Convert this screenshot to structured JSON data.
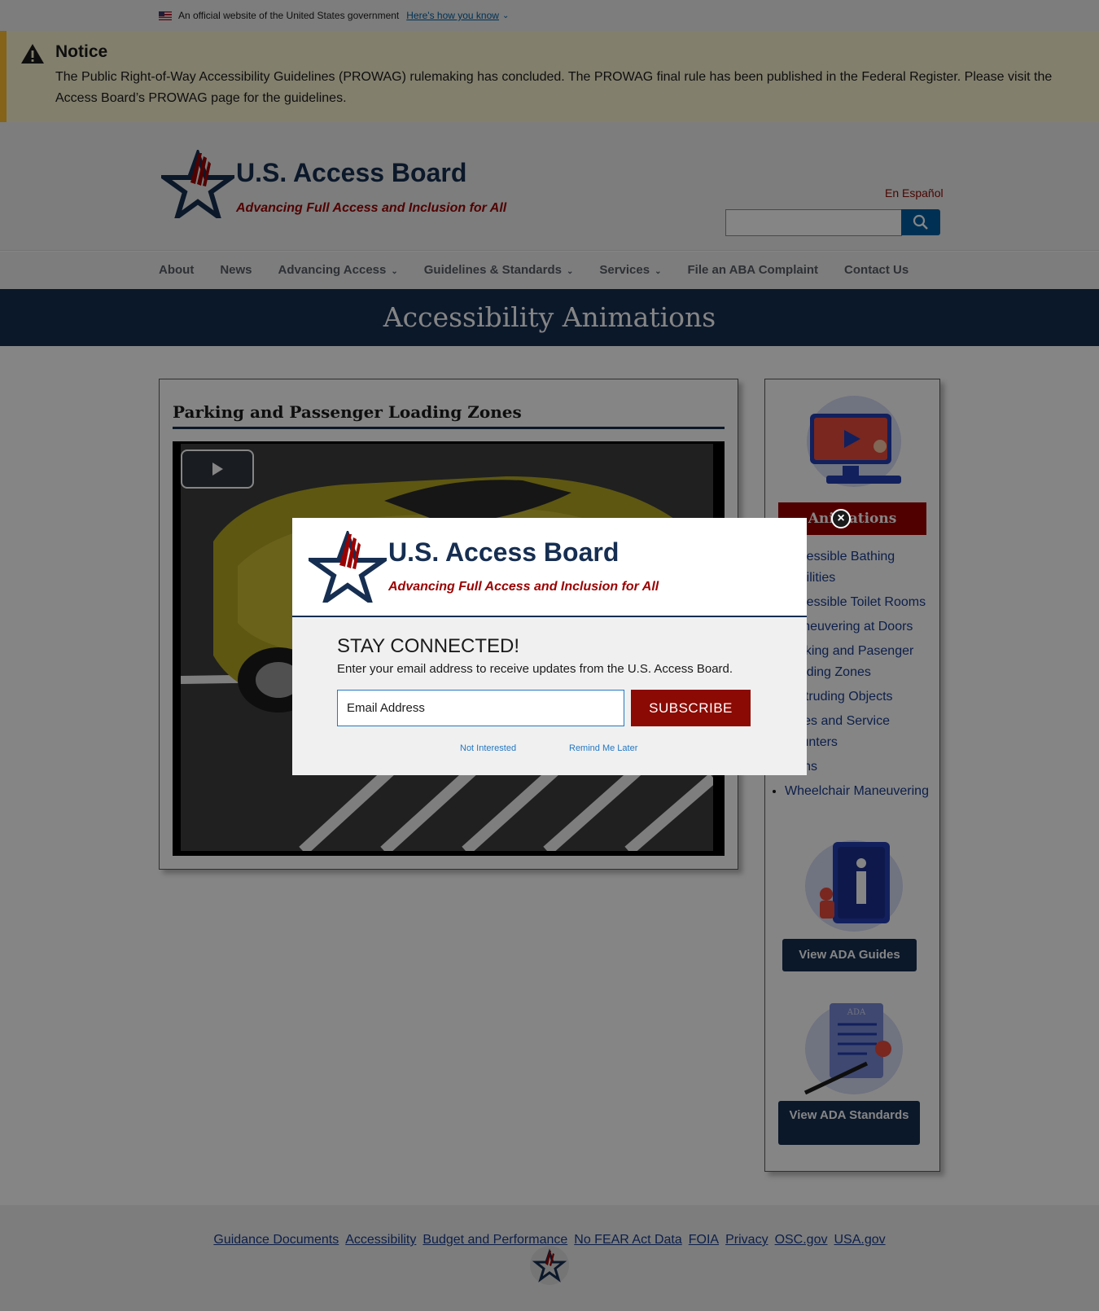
{
  "gov_banner": {
    "official_text": "An official website of the United States government",
    "how_link": "Here's how you know"
  },
  "notice": {
    "heading": "Notice",
    "body": "The Public Right-of-Way Accessibility Guidelines (PROWAG) rulemaking has concluded. The PROWAG final rule has been published in the Federal Register. Please visit the Access Board’s PROWAG page for the guidelines."
  },
  "header": {
    "title": "U.S. Access Board",
    "tagline": "Advancing Full Access and Inclusion for All",
    "language_link": "En Español",
    "search_placeholder": ""
  },
  "nav": {
    "items": [
      {
        "label": "About",
        "has_menu": false
      },
      {
        "label": "News",
        "has_menu": false
      },
      {
        "label": "Advancing Access",
        "has_menu": true
      },
      {
        "label": "Guidelines & Standards",
        "has_menu": true
      },
      {
        "label": "Services",
        "has_menu": true
      },
      {
        "label": "File an ABA Complaint",
        "has_menu": false
      },
      {
        "label": "Contact Us",
        "has_menu": false
      }
    ]
  },
  "page": {
    "title": "Accessibility Animations"
  },
  "video": {
    "heading": "Parking and Passenger Loading Zones",
    "heading_display": "Parking and Pasenger Loading Zones"
  },
  "sidebar": {
    "animations_label": "Animations",
    "animation_items": [
      "Accessible Bathing Facilities",
      "Accessible Toilet Rooms",
      "Maneuvering at Doors",
      "Parking and Pasenger Loading Zones",
      "Protruding Objects",
      "Sales and Service Counters",
      "Signs",
      "Wheelchair Maneuvering"
    ],
    "ada_guides_button": "View ADA Guides",
    "ada_standards_button": "View ADA Standards",
    "standards_doc_label": "ADA"
  },
  "footer": {
    "links": [
      "Guidance Documents",
      "Accessibility",
      "Budget and Performance",
      "No FEAR Act Data",
      "FOIA",
      "Privacy",
      "OSC.gov",
      "USA.gov"
    ]
  },
  "modal": {
    "title": "U.S. Access Board",
    "tagline": "Advancing Full Access and Inclusion for All",
    "heading": "STAY CONNECTED!",
    "subtext": "Enter your email address to receive updates from the U.S. Access Board.",
    "email_placeholder": "Email Address",
    "subscribe_label": "SUBSCRIBE",
    "not_interested": "Not Interested",
    "remind_later": "Remind Me Later",
    "close_symbol": "×"
  },
  "colors": {
    "navy": "#162e51",
    "brand_red": "#9b0000",
    "link_blue": "#005ea2",
    "notice_bg": "#faf3d1",
    "notice_accent": "#ffbe2e"
  }
}
